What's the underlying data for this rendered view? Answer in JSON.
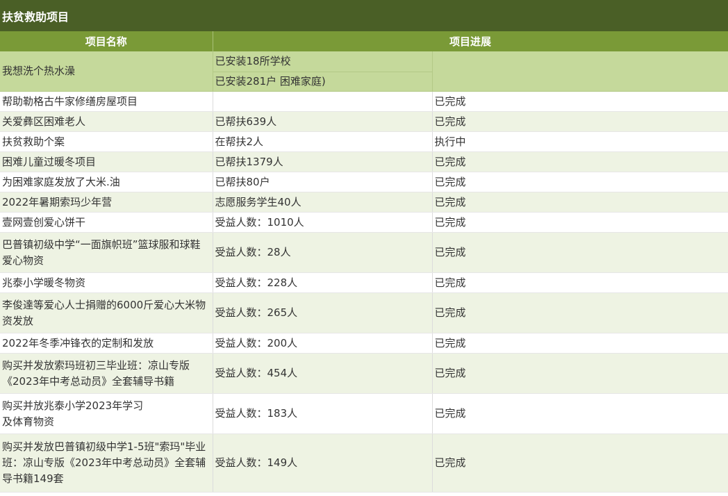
{
  "title": "扶贫救助项目",
  "headers": {
    "name": "项目名称",
    "progress": "项目进展"
  },
  "first_row": {
    "name": "我想洗个热水澡",
    "details": [
      "已安装18所学校",
      "已安装281户 困难家庭)"
    ],
    "status": ""
  },
  "rows": [
    {
      "name": "帮助勒格古牛家修缮房屋项目",
      "detail": "",
      "status": "已完成"
    },
    {
      "name": "关爱彝区困难老人",
      "detail": "已帮扶639人",
      "status": "已完成"
    },
    {
      "name": "扶贫救助个案",
      "detail": "在帮扶2人",
      "status": "执行中"
    },
    {
      "name": "困难儿童过暖冬项目",
      "detail": "已帮扶1379人",
      "status": "已完成"
    },
    {
      "name": "为困难家庭发放了大米.油",
      "detail": "已帮扶80户",
      "status": "已完成"
    },
    {
      "name": "2022年暑期索玛少年营",
      "detail": "志愿服务学生40人",
      "status": "已完成"
    },
    {
      "name": "壹网壹创爱心饼干",
      "detail": "受益人数：1010人",
      "status": "已完成"
    },
    {
      "name": "巴普镇初级中学“一面旗帜班”篮球服和球鞋爱心物资",
      "detail": "受益人数：28人",
      "status": "已完成"
    },
    {
      "name": "兆泰小学暖冬物资",
      "detail": "受益人数：228人",
      "status": "已完成"
    },
    {
      "name": "李俊達等爱心人士捐赠的6000斤爱心大米物资发放",
      "detail": "受益人数：265人",
      "status": "已完成"
    },
    {
      "name": "2022年冬季冲锋衣的定制和发放",
      "detail": "受益人数：200人",
      "status": "已完成"
    },
    {
      "name": "购买并发放索玛班初三毕业班：凉山专版《2023年中考总动员》全套辅导书籍",
      "detail": "受益人数：454人",
      "status": "已完成"
    },
    {
      "name": "购买并放兆泰小学2023年学习\n及体育物资",
      "detail": "受益人数：183人",
      "status": "已完成"
    },
    {
      "name": "购买并发放巴普镇初级中学1-5班\"索玛\"毕业班：凉山专版《2023年中考总动员》全套辅导书籍149套",
      "detail": "受益人数：149人",
      "status": "已完成"
    }
  ]
}
